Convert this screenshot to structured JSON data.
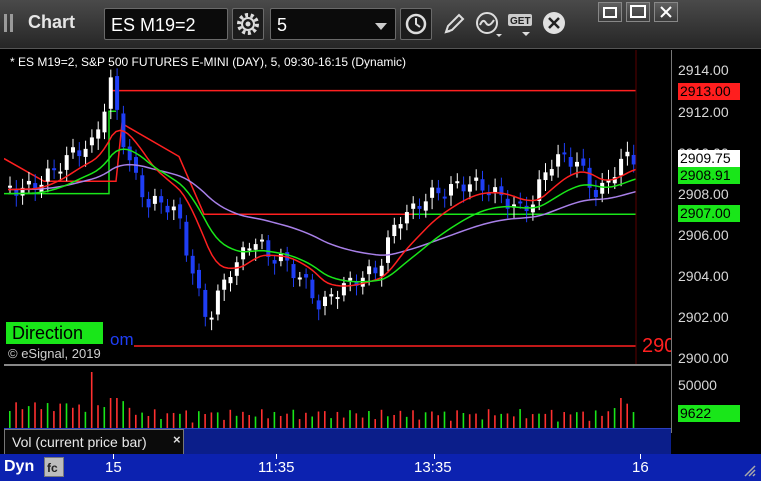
{
  "window": {
    "title": "Chart"
  },
  "toolbar": {
    "symbol": "ES M19=2",
    "interval": "5"
  },
  "chart": {
    "header": "* ES M19=2, S&P 500 FUTURES E-MINI (DAY), 5, 09:30-16:15 (Dynamic)",
    "direction_label": "Direction",
    "partial_text": "om",
    "copyright": "© eSignal, 2019",
    "low_label_partial": "290",
    "y_ticks": [
      "2914.00",
      "2912.00",
      "2910.00",
      "2908.00",
      "2906.00",
      "2904.00",
      "2902.00",
      "2900.00"
    ],
    "price_tags": [
      {
        "id": "red-level",
        "text": "2913.00",
        "bg": "#ff1e1e",
        "fg": "#000000"
      },
      {
        "id": "last-price",
        "text": "2909.75",
        "bg": "#ffffff",
        "fg": "#000000"
      },
      {
        "id": "green-ma",
        "text": "2908.91",
        "bg": "#19e619",
        "fg": "#000000"
      },
      {
        "id": "green-level",
        "text": "2907.00",
        "bg": "#19e619",
        "fg": "#000000"
      }
    ],
    "colors": {
      "up": "#ffffff",
      "down": "#1f3ef5",
      "red": "#ff2020",
      "green": "#19e619",
      "purple": "#a880e8"
    }
  },
  "volume": {
    "label": "Vol (current price bar)",
    "y_tick": "50000",
    "current_tag": "9622",
    "tag_bg": "#19e619"
  },
  "statusbar": {
    "mode": "Dyn",
    "x_labels": [
      "15",
      "11:35",
      "13:35",
      "16"
    ]
  },
  "icons": [
    "grip-icon",
    "settings-gear-icon",
    "clock-icon",
    "pencil-icon",
    "wave-icon",
    "get-icon",
    "close-circle-icon",
    "restore-icon",
    "maximize-icon",
    "close-icon",
    "fc-icon",
    "resize-grip-icon"
  ]
}
